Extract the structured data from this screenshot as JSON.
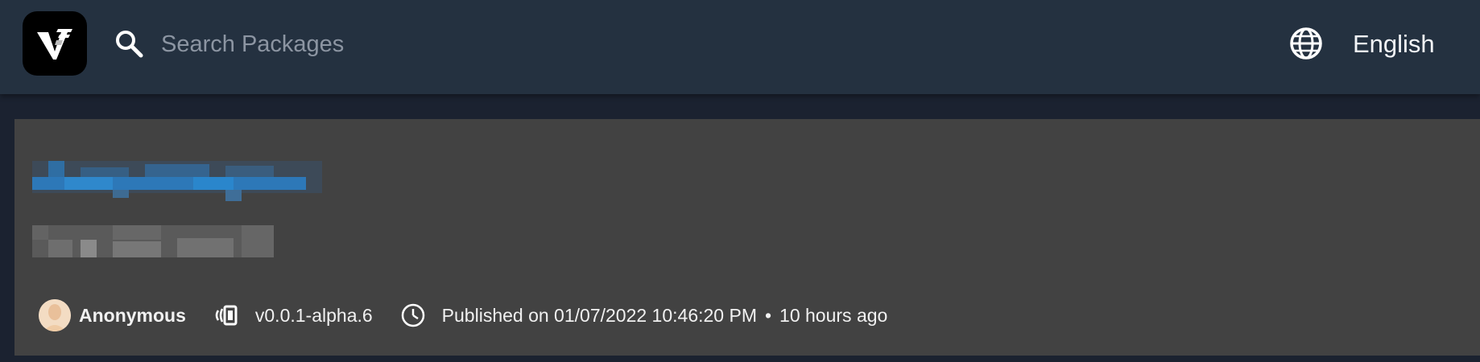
{
  "header": {
    "search_placeholder": "Search Packages",
    "language": "English"
  },
  "package": {
    "author": "Anonymous",
    "version": "v0.0.1-alpha.6",
    "published": "Published on 01/07/2022 10:46:20 PM",
    "separator": "•",
    "relative_time": "10 hours ago"
  },
  "colors": {
    "header_bg": "#243140",
    "page_bg": "#1b2230",
    "card_bg": "#424242",
    "link_blue": "#2f86c8"
  },
  "icons": [
    "logo-icon",
    "search-icon",
    "globe-icon",
    "avatar",
    "version-icon",
    "clock-icon"
  ]
}
